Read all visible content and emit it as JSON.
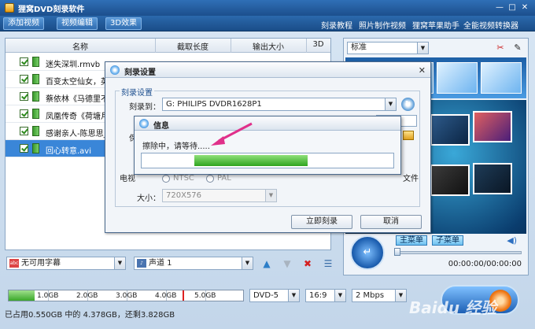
{
  "app": {
    "title": "狸窝DVD刻录软件"
  },
  "toolbar": {
    "add_video": "添加视频",
    "edit_video": "视频编辑",
    "effect_3d": "3D效果",
    "links": [
      "刻录教程",
      "照片制作视频",
      "狸窝苹果助手",
      "全能视频转换器"
    ]
  },
  "list": {
    "headers": [
      "名称",
      "截取长度",
      "输出大小",
      "3D"
    ],
    "rows": [
      {
        "name": "迷失深圳.rmvb",
        "selected": false
      },
      {
        "name": "百变太空仙女，英",
        "selected": false
      },
      {
        "name": "蔡依林《马德里不",
        "selected": false
      },
      {
        "name": "凤凰传奇《荷塘月",
        "selected": false
      },
      {
        "name": "感谢亲人-陈思思_",
        "selected": false
      },
      {
        "name": "回心转意.avi",
        "selected": true
      }
    ]
  },
  "preview": {
    "style_value": "标准",
    "main_menu": "主菜单",
    "sub_menu": "子菜单",
    "timecode": "00:00:00/00:00:00"
  },
  "controls": {
    "subtitle_value": "无可用字幕",
    "audio_value": "声道 1"
  },
  "capacity": {
    "labels": [
      "1.0GB",
      "2.0GB",
      "3.0GB",
      "4.0GB",
      "5.0GB"
    ],
    "used_fraction": 0.11,
    "disc_type": "DVD-5",
    "aspect": "16:9",
    "bitrate": "2 Mbps",
    "status": "已占用0.550GB 中的 4.378GB，还剩3.828GB"
  },
  "burn_dialog": {
    "title": "刻录设置",
    "group": "刻录设置",
    "burn_to_label": "刻录到：",
    "drive": "G: PHILIPS  DVDR1628P1",
    "save_label_partial": "保",
    "tv_label_partial": "电视",
    "opt_ntsc": "NTSC",
    "opt_pal": "PAL",
    "file_partial": "文件",
    "size_label": "大小：",
    "size_value": "720X576",
    "burn_now": "立即刻录",
    "cancel": "取消"
  },
  "info_dialog": {
    "title": "信息",
    "message": "擦除中，请等待.....",
    "progress_start": 0.21,
    "progress_fraction": 0.45
  },
  "watermark": "Baidu 经验",
  "colors": {
    "accent": "#2f6fb6",
    "progress": "#2fa51f",
    "selection": "#3a86d8"
  }
}
